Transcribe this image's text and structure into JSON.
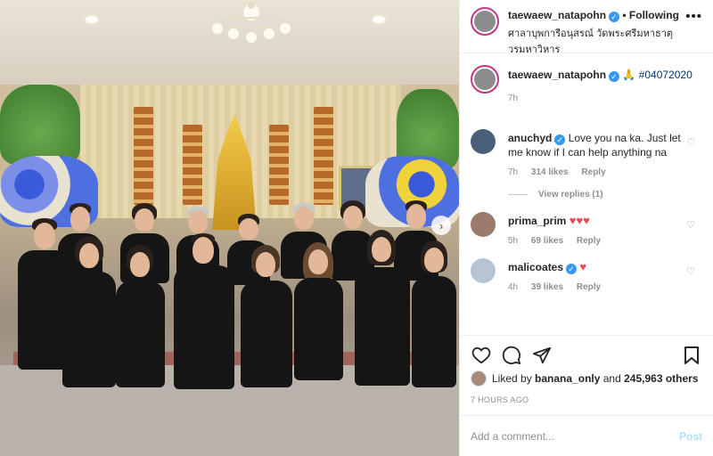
{
  "header": {
    "username": "taewaew_natapohn",
    "verified_icon": "verified-badge-icon",
    "separator": "•",
    "follow_status": "Following",
    "location": "ศาลาบุพการีอนุสรณ์ วัดพระศรีมหาธาตุวรมหาวิหาร",
    "more_icon": "more-options-icon",
    "more_glyph": "•••"
  },
  "caption": {
    "username": "taewaew_natapohn",
    "emoji": "🙏",
    "hashtag": "#04072020",
    "time": "7h"
  },
  "comments": [
    {
      "username": "anuchyd",
      "verified": true,
      "text": "Love you na ka. Just let me know if I can help anything na",
      "time": "7h",
      "likes": "314 likes",
      "reply": "Reply",
      "avatar_color": "#4a5f7a"
    },
    {
      "username": "prima_prim",
      "verified": false,
      "text": "♥♥♥",
      "time": "5h",
      "likes": "69 likes",
      "reply": "Reply",
      "avatar_color": "#9b7b6b"
    },
    {
      "username": "malicoates",
      "verified": true,
      "text": "♥",
      "time": "4h",
      "likes": "39 likes",
      "reply": "Reply",
      "avatar_color": "#b6c4d6"
    }
  ],
  "view_replies": "View replies (1)",
  "actions": {
    "like_icon": "heart-icon",
    "comment_icon": "comment-icon",
    "share_icon": "share-icon",
    "save_icon": "bookmark-icon"
  },
  "likes": {
    "prefix": "Liked by",
    "user": "banana_only",
    "connector": "and",
    "count": "245,963 others"
  },
  "posted_time": "7 HOURS AGO",
  "add_comment": {
    "placeholder": "Add a comment...",
    "post_label": "Post"
  },
  "colors": {
    "verified": "#3897f0",
    "heart_red": "#ed4956",
    "post_button": "#b2dffc",
    "story_ring": "#c13584"
  }
}
